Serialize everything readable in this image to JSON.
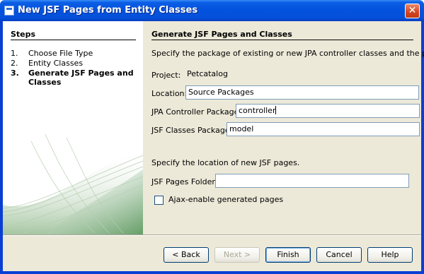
{
  "window": {
    "title": "New JSF Pages from Entity Classes",
    "close_glyph": "✕"
  },
  "steps": {
    "header": "Steps",
    "items": [
      {
        "num": "1.",
        "label": "Choose File Type"
      },
      {
        "num": "2.",
        "label": "Entity Classes"
      },
      {
        "num": "3.",
        "label": "Generate JSF Pages and Classes"
      }
    ]
  },
  "content": {
    "header": "Generate JSF Pages and Classes",
    "description": "Specify the package of existing or new JPA controller classes and the package",
    "project_label": "Project:",
    "project_value": "Petcatalog",
    "location_label": "Location:",
    "location_value": "Source Packages",
    "jpa_label": "JPA Controller Package:",
    "jpa_value": "controller",
    "jsf_classes_label": "JSF Classes Package:",
    "jsf_classes_value": "model",
    "pages_description": "Specify the location of new JSF pages.",
    "pages_folder_label": "JSF Pages Folder:",
    "pages_folder_value": "",
    "ajax_label": "Ajax-enable generated pages",
    "ajax_checked": false
  },
  "buttons": {
    "back": "< Back",
    "next": "Next >",
    "finish": "Finish",
    "cancel": "Cancel",
    "help": "Help"
  },
  "colors": {
    "titlebar": "#0453de",
    "client": "#ece9d8",
    "field_border": "#7f9db9"
  }
}
